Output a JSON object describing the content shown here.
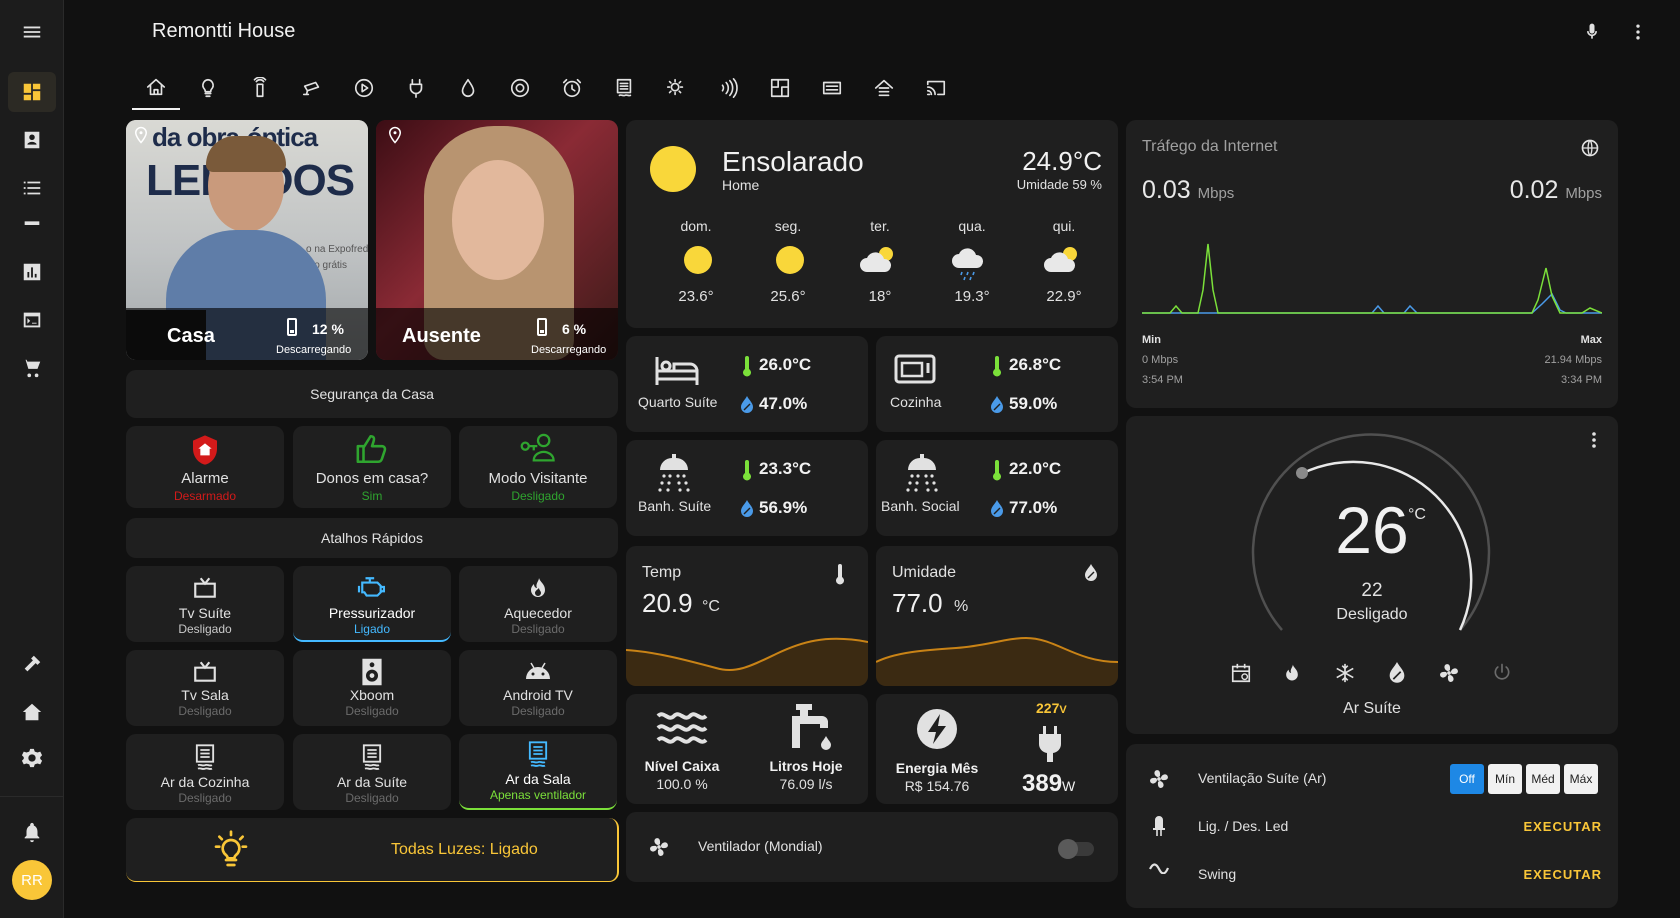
{
  "app": {
    "title": "Remontti House"
  },
  "people": [
    {
      "name": "Casa",
      "battery": "12 %",
      "status": "Descarregando"
    },
    {
      "name": "Ausente",
      "battery": "6 %",
      "status": "Descarregando"
    }
  ],
  "photo_text": {
    "line1": "da  obra-óptica",
    "line2": "LERADOS",
    "line3": "o na Expofred.",
    "line4": "io grátis"
  },
  "security": {
    "title": "Segurança da Casa",
    "items": [
      {
        "label": "Alarme",
        "state": "Desarmado"
      },
      {
        "label": "Donos em casa?",
        "state": "Sim"
      },
      {
        "label": "Modo Visitante",
        "state": "Desligado"
      }
    ]
  },
  "shortcuts": {
    "title": "Atalhos Rápidos",
    "items": [
      {
        "label": "Tv Suíte",
        "state": "Desligado"
      },
      {
        "label": "Pressurizador",
        "state": "Ligado"
      },
      {
        "label": "Aquecedor",
        "state": "Desligado"
      },
      {
        "label": "Tv Sala",
        "state": "Desligado"
      },
      {
        "label": "Xboom",
        "state": "Desligado"
      },
      {
        "label": "Android TV",
        "state": "Desligado"
      },
      {
        "label": "Ar da Cozinha",
        "state": "Desligado"
      },
      {
        "label": "Ar da Suíte",
        "state": "Desligado"
      },
      {
        "label": "Ar da Sala",
        "state": "Apenas ventilador"
      }
    ]
  },
  "lights": {
    "label": "Todas Luzes: Ligado"
  },
  "weather": {
    "condition": "Ensolarado",
    "location": "Home",
    "temp": "24.9°C",
    "humidity": "Umidade 59 %",
    "forecast": [
      {
        "day": "dom.",
        "temp": "23.6°",
        "icon": "sun-icon"
      },
      {
        "day": "seg.",
        "temp": "25.6°",
        "icon": "sun-icon"
      },
      {
        "day": "ter.",
        "temp": "18°",
        "icon": "partly-cloudy-icon"
      },
      {
        "day": "qua.",
        "temp": "19.3°",
        "icon": "rain-icon"
      },
      {
        "day": "qui.",
        "temp": "22.9°",
        "icon": "partly-cloudy-icon"
      }
    ]
  },
  "rooms": [
    {
      "name": "Quarto Suíte",
      "temp": "26.0°C",
      "hum": "47.0%"
    },
    {
      "name": "Cozinha",
      "temp": "26.8°C",
      "hum": "59.0%"
    },
    {
      "name": "Banh. Suíte",
      "temp": "23.3°C",
      "hum": "56.9%"
    },
    {
      "name": "Banh. Social",
      "temp": "22.0°C",
      "hum": "77.0%"
    }
  ],
  "sensors": [
    {
      "name": "Temp",
      "value": "20.9",
      "unit": "°C"
    },
    {
      "name": "Umidade",
      "value": "77.0",
      "unit": "%"
    }
  ],
  "water": {
    "tank_label": "Nível Caixa",
    "tank_value": "100.0 %",
    "liters_label": "Litros Hoje",
    "liters_value": "76.09 l/s"
  },
  "energy": {
    "label": "Energia Mês",
    "cost": "R$ 154.76",
    "voltage": "227",
    "voltage_unit": "V",
    "power": "389",
    "power_unit": "W"
  },
  "fan": {
    "label": "Ventilador (Mondial)"
  },
  "traffic": {
    "title": "Tráfego da Internet",
    "down": "0.03",
    "up": "0.02",
    "unit": "Mbps",
    "min_label": "Min",
    "max_label": "Max",
    "min_value": "0 Mbps",
    "max_value": "21.94 Mbps",
    "min_time": "3:54 PM",
    "max_time": "3:34 PM"
  },
  "thermostat": {
    "target": "26",
    "unit": "°C",
    "current": "22",
    "state": "Desligado",
    "name": "Ar Suíte"
  },
  "controls": {
    "vent_label": "Ventilação Suíte (Ar)",
    "vent_options": [
      "Off",
      "Mín",
      "Méd",
      "Máx"
    ],
    "led_label": "Lig. / Des. Led",
    "led_action": "EXECUTAR",
    "swing_label": "Swing",
    "swing_action": "EXECUTAR"
  },
  "user": {
    "initials": "RR"
  },
  "colors": {
    "accent": "#f9c638",
    "blue": "#44b9ff",
    "green": "#7be03a",
    "orange": "#c98316",
    "drop": "#4a9ae8"
  }
}
